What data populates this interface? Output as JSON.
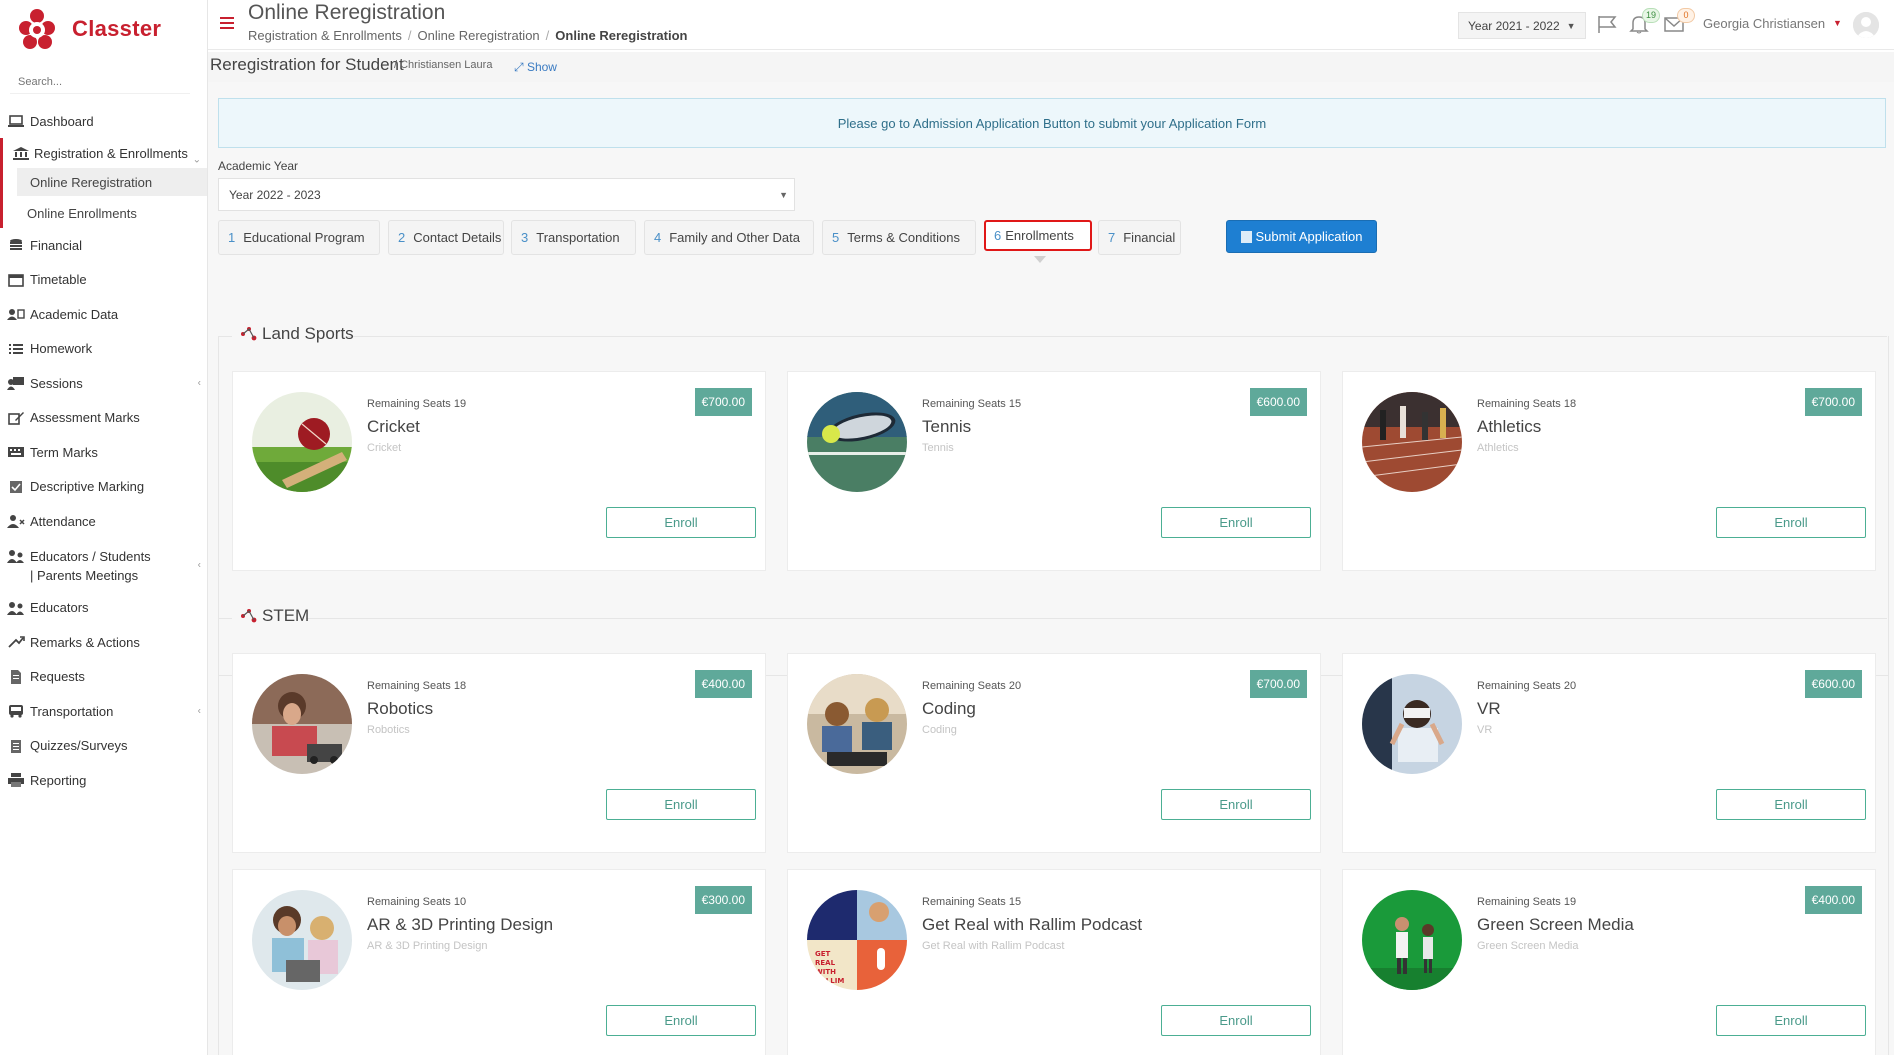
{
  "app": {
    "name": "Classter",
    "brand_color": "#c8202f"
  },
  "search": {
    "placeholder": "Search..."
  },
  "sidebar": {
    "items": [
      {
        "label": "Dashboard",
        "icon": "laptop-icon"
      },
      {
        "label": "Registration & Enrollments",
        "icon": "bank-icon"
      },
      {
        "label": "Online Reregistration"
      },
      {
        "label": "Online Enrollments"
      },
      {
        "label": "Financial",
        "icon": "coins-icon"
      },
      {
        "label": "Timetable",
        "icon": "calendar-icon"
      },
      {
        "label": "Academic Data",
        "icon": "id-card-icon"
      },
      {
        "label": "Homework",
        "icon": "list-icon"
      },
      {
        "label": "Sessions",
        "icon": "presentation-icon"
      },
      {
        "label": "Assessment Marks",
        "icon": "edit-icon"
      },
      {
        "label": "Term Marks",
        "icon": "keyboard-icon"
      },
      {
        "label": "Descriptive Marking",
        "icon": "check-square-icon"
      },
      {
        "label": "Attendance",
        "icon": "user-x-icon"
      },
      {
        "label": "Educators / Students | Parents Meetings",
        "icon": "users-meeting-icon"
      },
      {
        "label": "Educators",
        "icon": "users-icon"
      },
      {
        "label": "Remarks & Actions",
        "icon": "shuffle-icon"
      },
      {
        "label": "Requests",
        "icon": "document-icon"
      },
      {
        "label": "Transportation",
        "icon": "bus-icon"
      },
      {
        "label": "Quizzes/Surveys",
        "icon": "clipboard-icon"
      },
      {
        "label": "Reporting",
        "icon": "printer-icon"
      }
    ]
  },
  "header": {
    "title": "Online Reregistration",
    "breadcrumb": [
      "Registration & Enrollments",
      "Online Reregistration",
      "Online Reregistration"
    ],
    "year": "Year 2021 - 2022",
    "notifications_count": "19",
    "messages_count": "0",
    "user": "Georgia Christiansen"
  },
  "subheader": {
    "title": "Reregistration for Student",
    "student": "/ Christiansen Laura",
    "show": "Show"
  },
  "notice": "Please go to Admission Application Button to submit your Application Form",
  "academic_year": {
    "label": "Academic Year",
    "value": "Year 2022 - 2023"
  },
  "tabs": [
    {
      "num": "1",
      "label": "Educational Program"
    },
    {
      "num": "2",
      "label": "Contact Details"
    },
    {
      "num": "3",
      "label": "Transportation"
    },
    {
      "num": "4",
      "label": "Family and Other Data"
    },
    {
      "num": "5",
      "label": "Terms & Conditions"
    },
    {
      "num": "6",
      "label": "Enrollments"
    },
    {
      "num": "7",
      "label": "Financial"
    }
  ],
  "submit_label": "Submit Application",
  "sections": [
    {
      "title": "Land Sports",
      "cards": [
        {
          "seats_label": "Remaining Seats",
          "seats": "19",
          "title": "Cricket",
          "subtitle": "Cricket",
          "price": "€700.00",
          "enroll": "Enroll",
          "image": "cricket-ball-image"
        },
        {
          "seats_label": "Remaining Seats",
          "seats": "15",
          "title": "Tennis",
          "subtitle": "Tennis",
          "price": "€600.00",
          "enroll": "Enroll",
          "image": "tennis-racket-image"
        },
        {
          "seats_label": "Remaining Seats",
          "seats": "18",
          "title": "Athletics",
          "subtitle": "Athletics",
          "price": "€700.00",
          "enroll": "Enroll",
          "image": "running-track-image"
        }
      ]
    },
    {
      "title": "STEM",
      "cards": [
        {
          "seats_label": "Remaining Seats",
          "seats": "18",
          "title": "Robotics",
          "subtitle": "Robotics",
          "price": "€400.00",
          "enroll": "Enroll",
          "image": "robotics-kids-image"
        },
        {
          "seats_label": "Remaining Seats",
          "seats": "20",
          "title": "Coding",
          "subtitle": "Coding",
          "price": "€700.00",
          "enroll": "Enroll",
          "image": "coding-kids-image"
        },
        {
          "seats_label": "Remaining Seats",
          "seats": "20",
          "title": "VR",
          "subtitle": "VR",
          "price": "€600.00",
          "enroll": "Enroll",
          "image": "vr-headset-image"
        },
        {
          "seats_label": "Remaining Seats",
          "seats": "10",
          "title": "AR & 3D Printing Design",
          "subtitle": "AR & 3D Printing Design",
          "price": "€300.00",
          "enroll": "Enroll",
          "image": "3d-printing-kids-image"
        },
        {
          "seats_label": "Remaining Seats",
          "seats": "15",
          "title": "Get Real with Rallim Podcast",
          "subtitle": "Get Real with Rallim Podcast",
          "price": "",
          "enroll": "Enroll",
          "image": "podcast-collage-image"
        },
        {
          "seats_label": "Remaining Seats",
          "seats": "19",
          "title": "Green Screen Media",
          "subtitle": "Green Screen Media",
          "price": "€400.00",
          "enroll": "Enroll",
          "image": "green-screen-image"
        }
      ]
    }
  ]
}
